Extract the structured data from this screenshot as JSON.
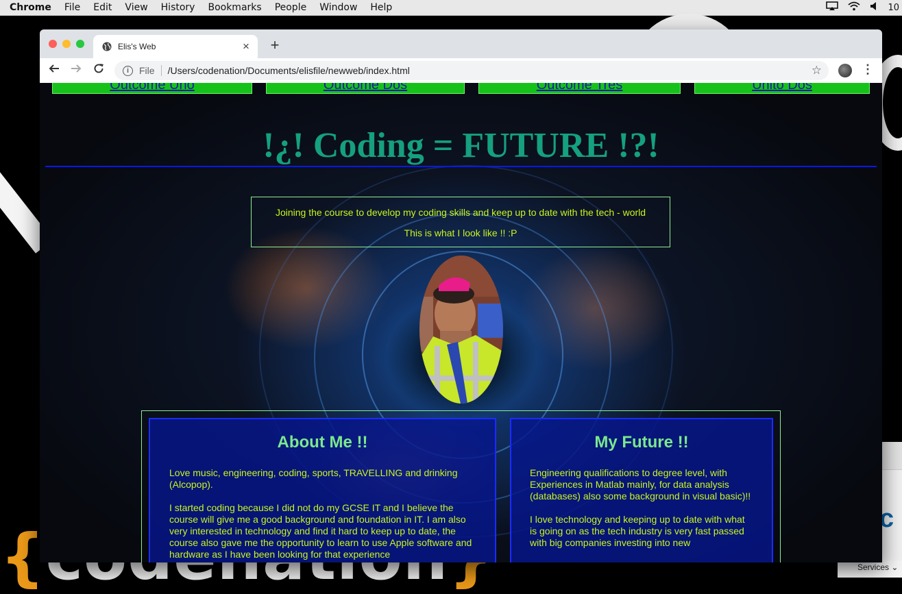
{
  "menubar": {
    "app": "Chrome",
    "items": [
      "File",
      "Edit",
      "View",
      "History",
      "Bookmarks",
      "People",
      "Window",
      "Help"
    ],
    "tray_icons": [
      "airplay-icon",
      "wifi-icon",
      "volume-icon"
    ],
    "clock_partial": "10"
  },
  "desktop": {
    "logo_text": "codenation",
    "services_label": "Services"
  },
  "browser": {
    "tab_title": "Elis's Web",
    "new_tab": "+",
    "close_tab": "×",
    "scheme": "File",
    "url": "/Users/codenation/Documents/elisfile/newweb/index.html"
  },
  "page": {
    "nav": [
      "Outcome Uno",
      "Outcome Dos",
      "Outcome Tres",
      "Unito Dos"
    ],
    "heading": "!¿! Coding = FUTURE !?!",
    "intro_line1": "Joining the course to develop my coding skills and keep up to date with the tech - world",
    "intro_line2": "This is what I look like !! :P",
    "about": {
      "title": "About Me !!",
      "para1": "Love music, engineering, coding, sports, TRAVELLING and drinking (Alcopop).",
      "para2": "I started coding because I did not do my GCSE IT and I believe the course will give me a good background and foundation in IT. I am also very interested in technology and find it hard to keep up to date, the course also gave me the opportunity to learn to use Apple software and hardware as I have been looking for that experience"
    },
    "future": {
      "title": "My Future !!",
      "para1": "Engineering qualifications to degree level, with Experiences in Matlab mainly, for data analysis (databases) also some background in visual basic)!!",
      "para2": "I love technology and keeping up to date with what is going on as the tech industry is very fast passed with big companies investing into new"
    }
  }
}
